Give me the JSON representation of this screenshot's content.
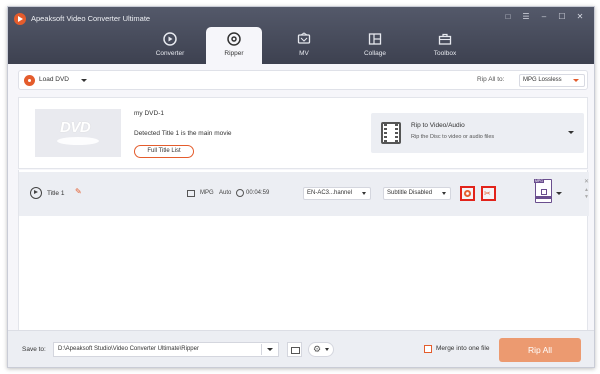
{
  "app": {
    "title": "Apeaksoft Video Converter Ultimate"
  },
  "window_controls": [
    "feedback",
    "menu",
    "minimize",
    "maximize",
    "close"
  ],
  "tabs": [
    {
      "label": "Converter",
      "icon": "converter-icon",
      "active": false
    },
    {
      "label": "Ripper",
      "icon": "ripper-icon",
      "active": true
    },
    {
      "label": "MV",
      "icon": "mv-icon",
      "active": false
    },
    {
      "label": "Collage",
      "icon": "collage-icon",
      "active": false
    },
    {
      "label": "Toolbox",
      "icon": "toolbox-icon",
      "active": false
    }
  ],
  "toolbar": {
    "load_dvd": "Load DVD",
    "rip_all_to_label": "Rip All to:",
    "rip_all_to_value": "MPG Lossless"
  },
  "source": {
    "thumb_text": "DVD",
    "name": "my DVD-1",
    "detected": "Detected Title 1 is the main movie",
    "full_title_button": "Full Title List",
    "rip_to_title": "Rip to Video/Audio",
    "rip_to_subtitle": "Rip the Disc to video or audio files"
  },
  "titles": [
    {
      "name": "Title 1",
      "format": "MPG",
      "resolution": "Auto",
      "duration": "00:04:59",
      "audio_track": "EN-AC3...hannel",
      "subtitle": "Subtitle Disabled",
      "output_format_tag": "MPG"
    }
  ],
  "bottom": {
    "save_to_label": "Save to:",
    "save_path": "D:\\Apeaksoft Studio\\Video Converter Ultimate\\Ripper",
    "merge_label": "Merge into one file",
    "merge_checked": false,
    "rip_all_button": "Rip All"
  },
  "colors": {
    "accent": "#e45c2c",
    "rip_button": "#ec9a70",
    "highlight_border": "#e2231a",
    "titlebar": "#454959"
  }
}
